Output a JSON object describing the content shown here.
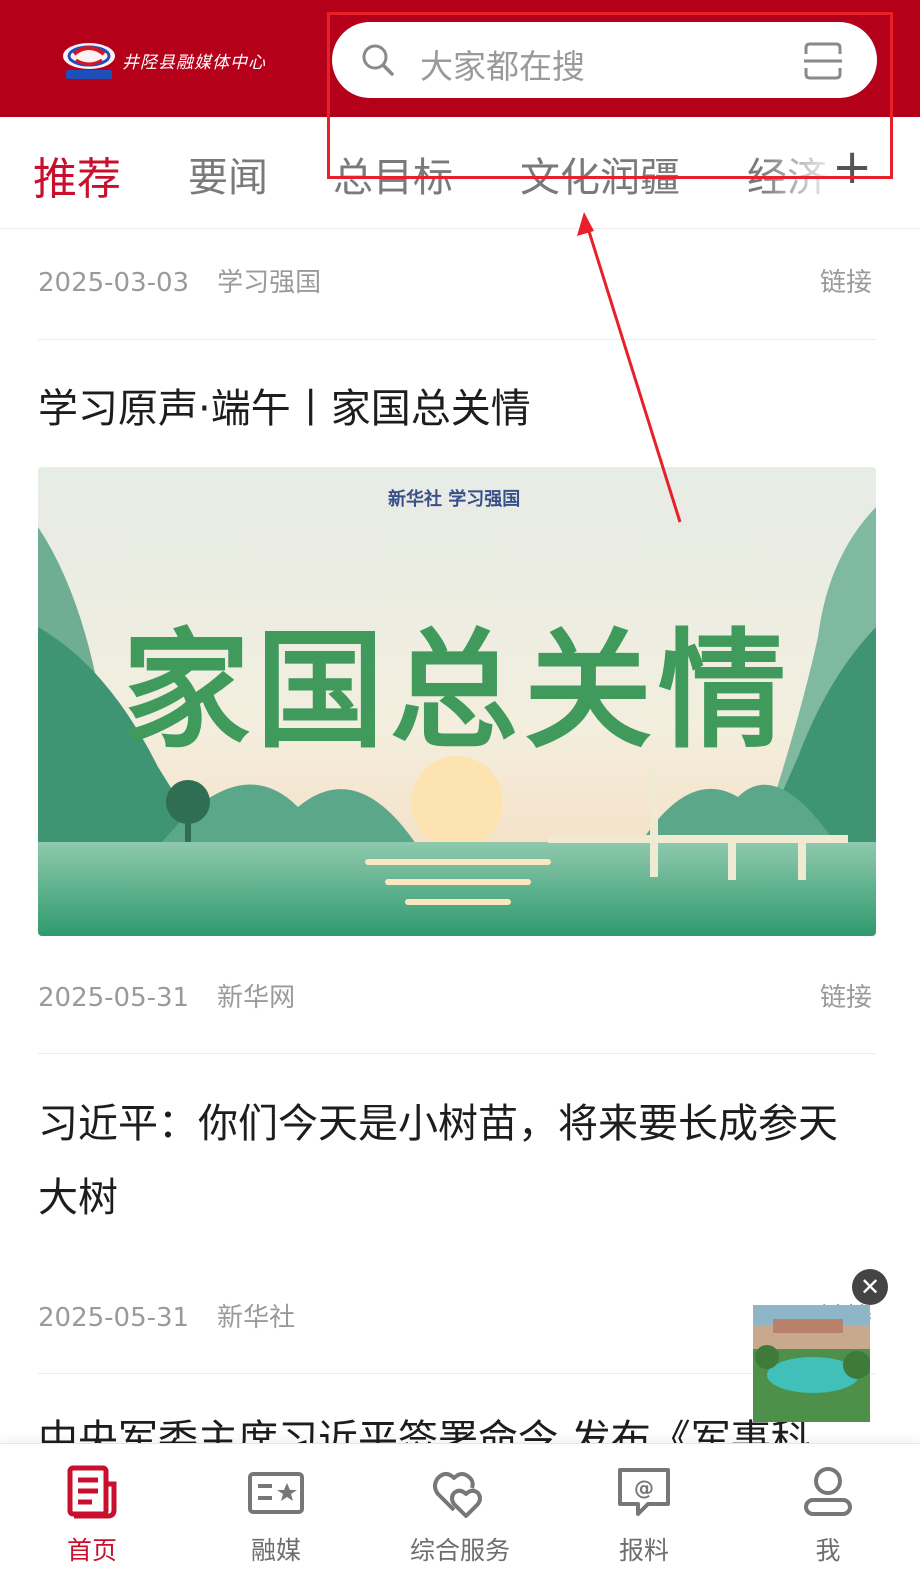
{
  "header": {
    "logo_text": "井陉县融媒体中心",
    "logo_sub": "融媒体中心",
    "search_placeholder": "大家都在搜"
  },
  "tabs": [
    {
      "label": "推荐",
      "active": true
    },
    {
      "label": "要闻",
      "active": false
    },
    {
      "label": "总目标",
      "active": false
    },
    {
      "label": "文化润疆",
      "active": false
    },
    {
      "label": "经济",
      "active": false
    }
  ],
  "tab_add": "+",
  "feed": [
    {
      "date": "2025-03-03",
      "source": "学习强国",
      "link": "链接"
    },
    {
      "title": "学习原声·端午丨家国总关情",
      "banner_text": "家国总关情",
      "banner_brand": "新华社 学习强国",
      "date": "2025-05-31",
      "source": "新华网",
      "link": "链接"
    },
    {
      "title": "习近平：你们今天是小树苗，将来要长成参天大树",
      "date": "2025-05-31",
      "source": "新华社",
      "link": "链接"
    },
    {
      "title": "中央军委主席习近平签署命令 发布《军事科"
    }
  ],
  "float_close": "✕",
  "bottom_nav": [
    {
      "label": "首页",
      "icon": "news-icon",
      "active": true
    },
    {
      "label": "融媒",
      "icon": "media-card-icon",
      "active": false
    },
    {
      "label": "综合服务",
      "icon": "hearts-icon",
      "active": false
    },
    {
      "label": "报料",
      "icon": "report-chat-icon",
      "active": false
    },
    {
      "label": "我",
      "icon": "user-icon",
      "active": false
    }
  ],
  "colors": {
    "brand_red": "#b5001a",
    "accent_red": "#c8102e",
    "annotation_red": "#e8202a"
  }
}
